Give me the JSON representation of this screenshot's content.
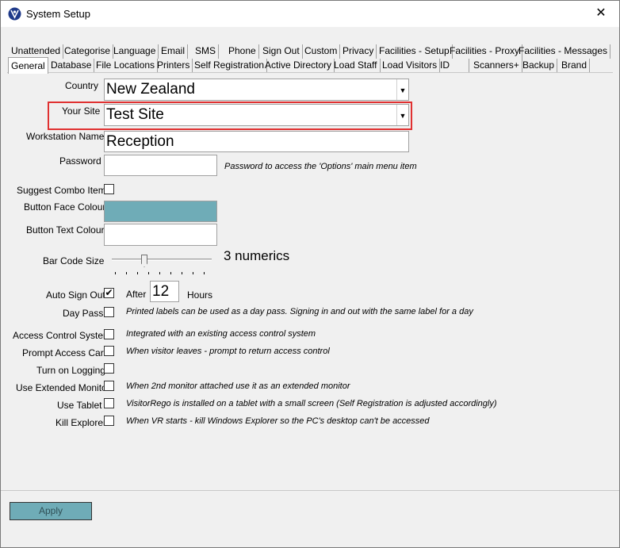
{
  "window": {
    "title": "System Setup",
    "close_label": "✕"
  },
  "tabs_row1": [
    "Unattended",
    "Categorise",
    "Language",
    "Email",
    "SMS",
    "Phone",
    "Sign Out",
    "Custom",
    "Privacy",
    "Facilities - Setup",
    "Facilities - Proxy",
    "Facilities - Messages"
  ],
  "tabs_row2": [
    "General",
    "Database",
    "File Locations",
    "Printers",
    "Self Registration",
    "Active Directory",
    "Load Staff",
    "Load Visitors",
    "ID",
    "Scanners+",
    "Backup",
    "Brand"
  ],
  "active_tab": "General",
  "form": {
    "country_label": "Country",
    "country_value": "New Zealand",
    "site_label": "Your Site",
    "site_value": "Test Site",
    "workstation_label": "Workstation Name",
    "workstation_value": "Reception",
    "password_label": "Password",
    "password_value": "",
    "password_hint": "Password to access the 'Options' main menu item",
    "suggest_label": "Suggest Combo Items",
    "suggest_checked": false,
    "face_colour_label": "Button Face Colour",
    "face_colour": "#6facb7",
    "text_colour_label": "Button Text Colour",
    "text_colour": "#ffffff",
    "barcode_label": "Bar Code Size",
    "barcode_value_text": "3 numerics",
    "barcode_level": 0.3,
    "auto_signout_label": "Auto Sign Out",
    "auto_signout_checked": true,
    "after_label": "After",
    "after_value": "12",
    "hours_label": "Hours",
    "day_pass_label": "Day Pass",
    "day_pass_hint": "Printed labels can be used as a day pass. Signing in and out with the same label for a day",
    "access_control_label": "Access Control System",
    "access_control_hint": "Integrated with an existing access control system",
    "prompt_card_label": "Prompt Access Card",
    "prompt_card_hint": "When visitor leaves - prompt to return access control",
    "logging_label": "Turn on Logging",
    "ext_monitor_label": "Use Extended Monitor",
    "ext_monitor_hint": "When 2nd monitor attached use it as an extended monitor",
    "tablet_label": "Use Tablet",
    "tablet_hint": "VisitorRego is installed on a tablet with a small screen (Self Registration is adjusted accordingly)",
    "kill_explorer_label": "Kill Explorer",
    "kill_explorer_hint": "When VR starts - kill Windows Explorer so the PC's desktop can't be accessed"
  },
  "apply_label": "Apply"
}
